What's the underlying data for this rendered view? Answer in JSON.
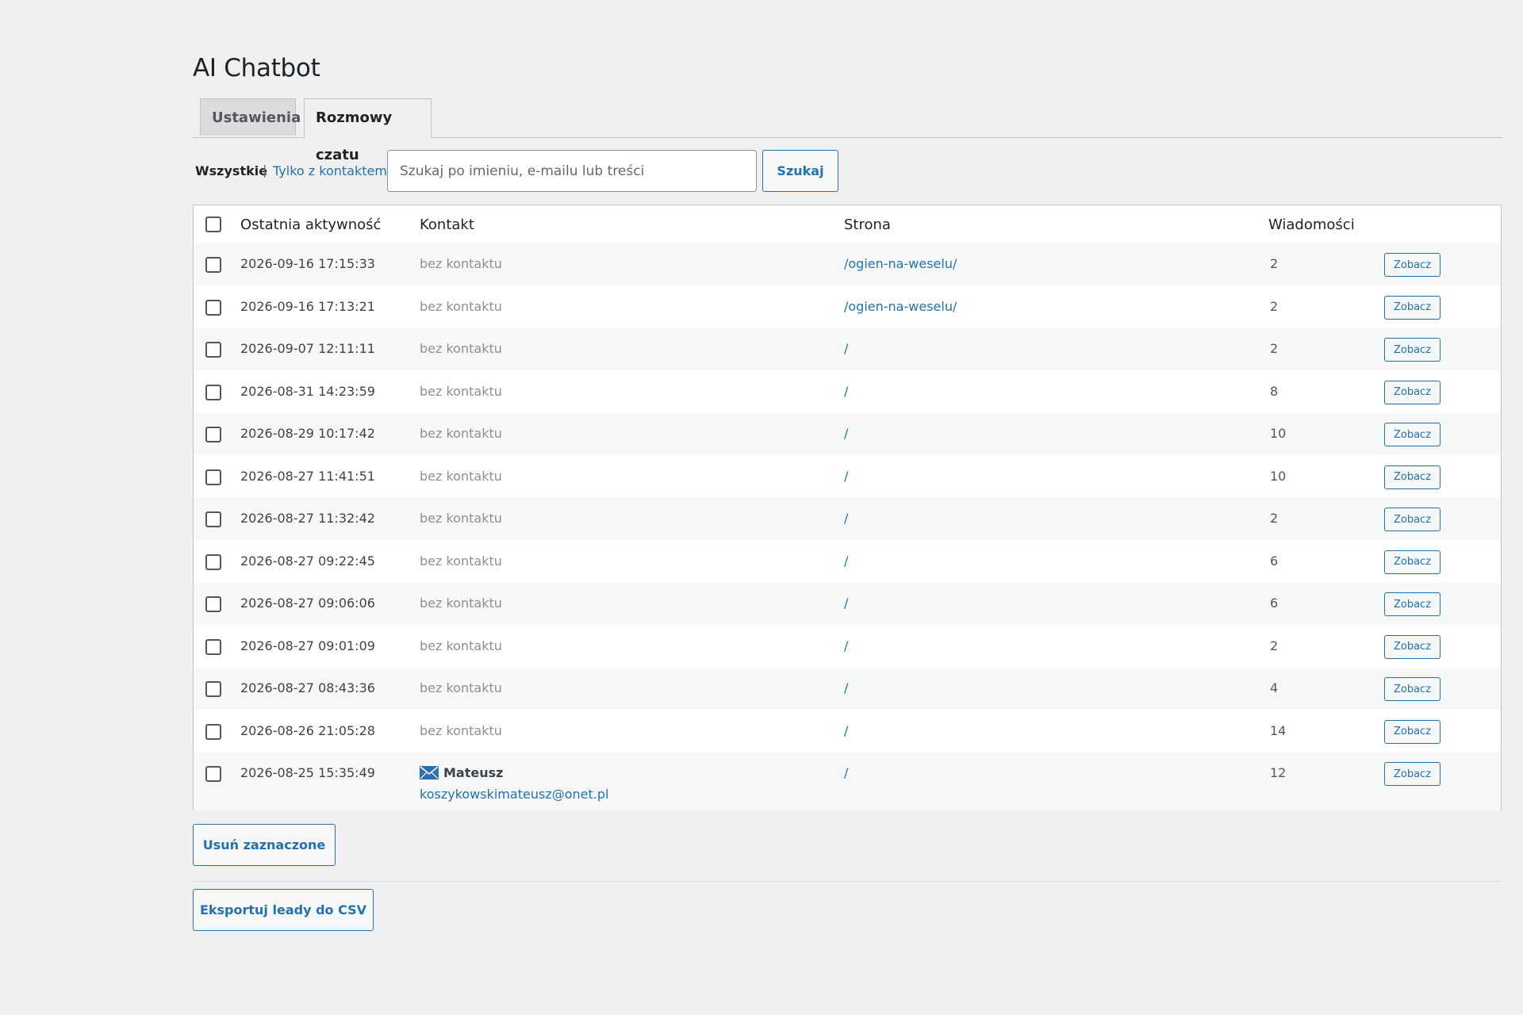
{
  "page": {
    "title": "AI Chatbot"
  },
  "tabs": [
    {
      "label": "Ustawienia",
      "active": false
    },
    {
      "label": "Rozmowy czatu",
      "active": true
    }
  ],
  "filters": {
    "all_label": "Wszystkie",
    "separator": "|",
    "contact_label": "Tylko z kontaktem",
    "search_placeholder": "Szukaj po imieniu, e-mailu lub treści",
    "search_value": "",
    "search_button": "Szukaj"
  },
  "table": {
    "headers": {
      "date": "Ostatnia aktywność",
      "contact": "Kontakt",
      "page": "Strona",
      "messages": "Wiadomości"
    },
    "view_label": "Zobacz",
    "rows": [
      {
        "date": "2026-09-16 17:15:33",
        "contact": "bez kontaktu",
        "page": "/ogien-na-weselu/",
        "messages": "2"
      },
      {
        "date": "2026-09-16 17:13:21",
        "contact": "bez kontaktu",
        "page": "/ogien-na-weselu/",
        "messages": "2"
      },
      {
        "date": "2026-09-07 12:11:11",
        "contact": "bez kontaktu",
        "page": "/",
        "messages": "2"
      },
      {
        "date": "2026-08-31 14:23:59",
        "contact": "bez kontaktu",
        "page": "/",
        "messages": "8"
      },
      {
        "date": "2026-08-29 10:17:42",
        "contact": "bez kontaktu",
        "page": "/",
        "messages": "10"
      },
      {
        "date": "2026-08-27 11:41:51",
        "contact": "bez kontaktu",
        "page": "/",
        "messages": "10"
      },
      {
        "date": "2026-08-27 11:32:42",
        "contact": "bez kontaktu",
        "page": "/",
        "messages": "2"
      },
      {
        "date": "2026-08-27 09:22:45",
        "contact": "bez kontaktu",
        "page": "/",
        "messages": "6"
      },
      {
        "date": "2026-08-27 09:06:06",
        "contact": "bez kontaktu",
        "page": "/",
        "messages": "6"
      },
      {
        "date": "2026-08-27 09:01:09",
        "contact": "bez kontaktu",
        "page": "/",
        "messages": "2"
      },
      {
        "date": "2026-08-27 08:43:36",
        "contact": "bez kontaktu",
        "page": "/",
        "messages": "4"
      },
      {
        "date": "2026-08-26 21:05:28",
        "contact": "bez kontaktu",
        "page": "/",
        "messages": "14"
      }
    ],
    "contact_row": {
      "date": "2026-08-25 15:35:49",
      "contact_name": "Mateusz",
      "contact_email": "koszykowskimateusz@onet.pl",
      "contact_icon": "mail-icon",
      "page": "/",
      "messages": "12"
    }
  },
  "actions": {
    "delete_selected": "Usuń zaznaczone",
    "export_csv": "Eksportuj leady do CSV"
  },
  "colors": {
    "accent": "#2271b1",
    "background": "#f0f0f1",
    "mail_icon": "#2c6fb7"
  }
}
